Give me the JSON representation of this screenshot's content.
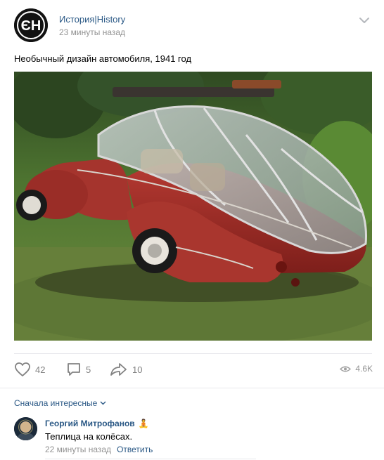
{
  "post": {
    "author": "История|History",
    "time": "23 минуты назад",
    "text": "Необычный дизайн автомобиля, 1941 год",
    "avatar_letters": "ЄH"
  },
  "image": {
    "description_icon": "vintage-car-photo"
  },
  "actions": {
    "likes": "42",
    "comments": "5",
    "shares": "10",
    "views": "4.6K"
  },
  "comments_section": {
    "sort_label": "Сначала интересные"
  },
  "comment": {
    "author": "Георгий Митрофанов",
    "badge_emoji": "🧘",
    "text": "Теплица на колёсах.",
    "time": "22 минуты назад",
    "reply_label": "Ответить"
  },
  "colors": {
    "link": "#2a5885",
    "muted": "#939393",
    "icon": "#828282"
  }
}
